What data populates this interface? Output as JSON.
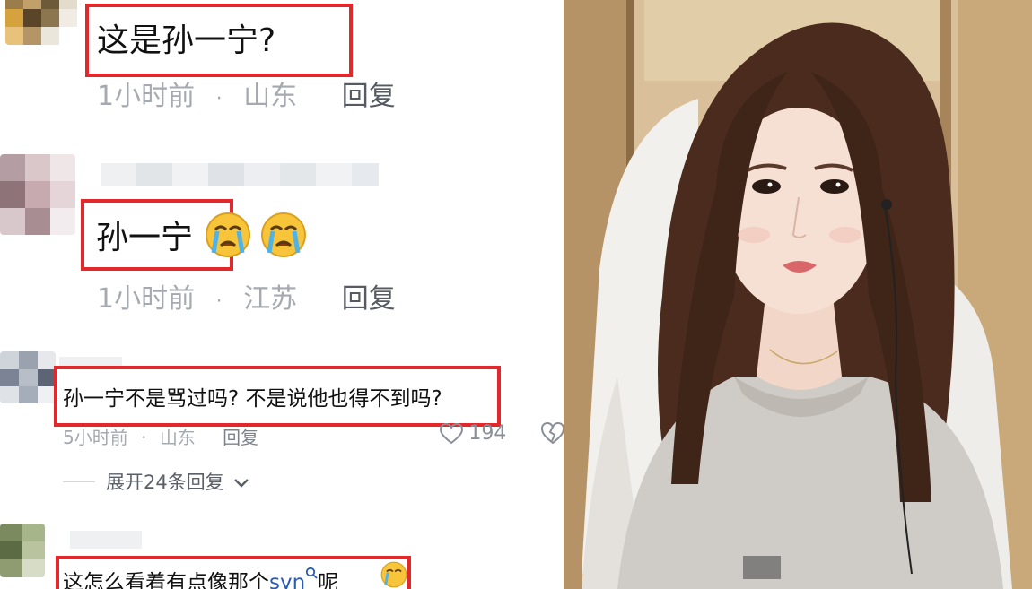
{
  "comments": [
    {
      "text": "这是孙一宁?",
      "time": "1小时前",
      "location": "山东",
      "reply": "回复"
    },
    {
      "text": "孙一宁",
      "time": "1小时前",
      "location": "江苏",
      "reply": "回复"
    },
    {
      "text": "孙一宁不是骂过吗? 不是说他也得不到吗?",
      "time": "5小时前",
      "location": "山东",
      "reply": "回复",
      "likes": "194"
    },
    {
      "text": "这怎么看着有点像那个",
      "tail": "呢",
      "link": "syn"
    }
  ],
  "expand_replies": "展开24条回复",
  "dot": "·",
  "colors": {
    "highlight": "#e2282b",
    "meta": "#a5a9b0",
    "link": "#2a5cb8"
  },
  "icons": [
    "crying-emoji-icon",
    "heart-icon",
    "broken-heart-icon",
    "chevron-down-icon",
    "search-icon"
  ]
}
